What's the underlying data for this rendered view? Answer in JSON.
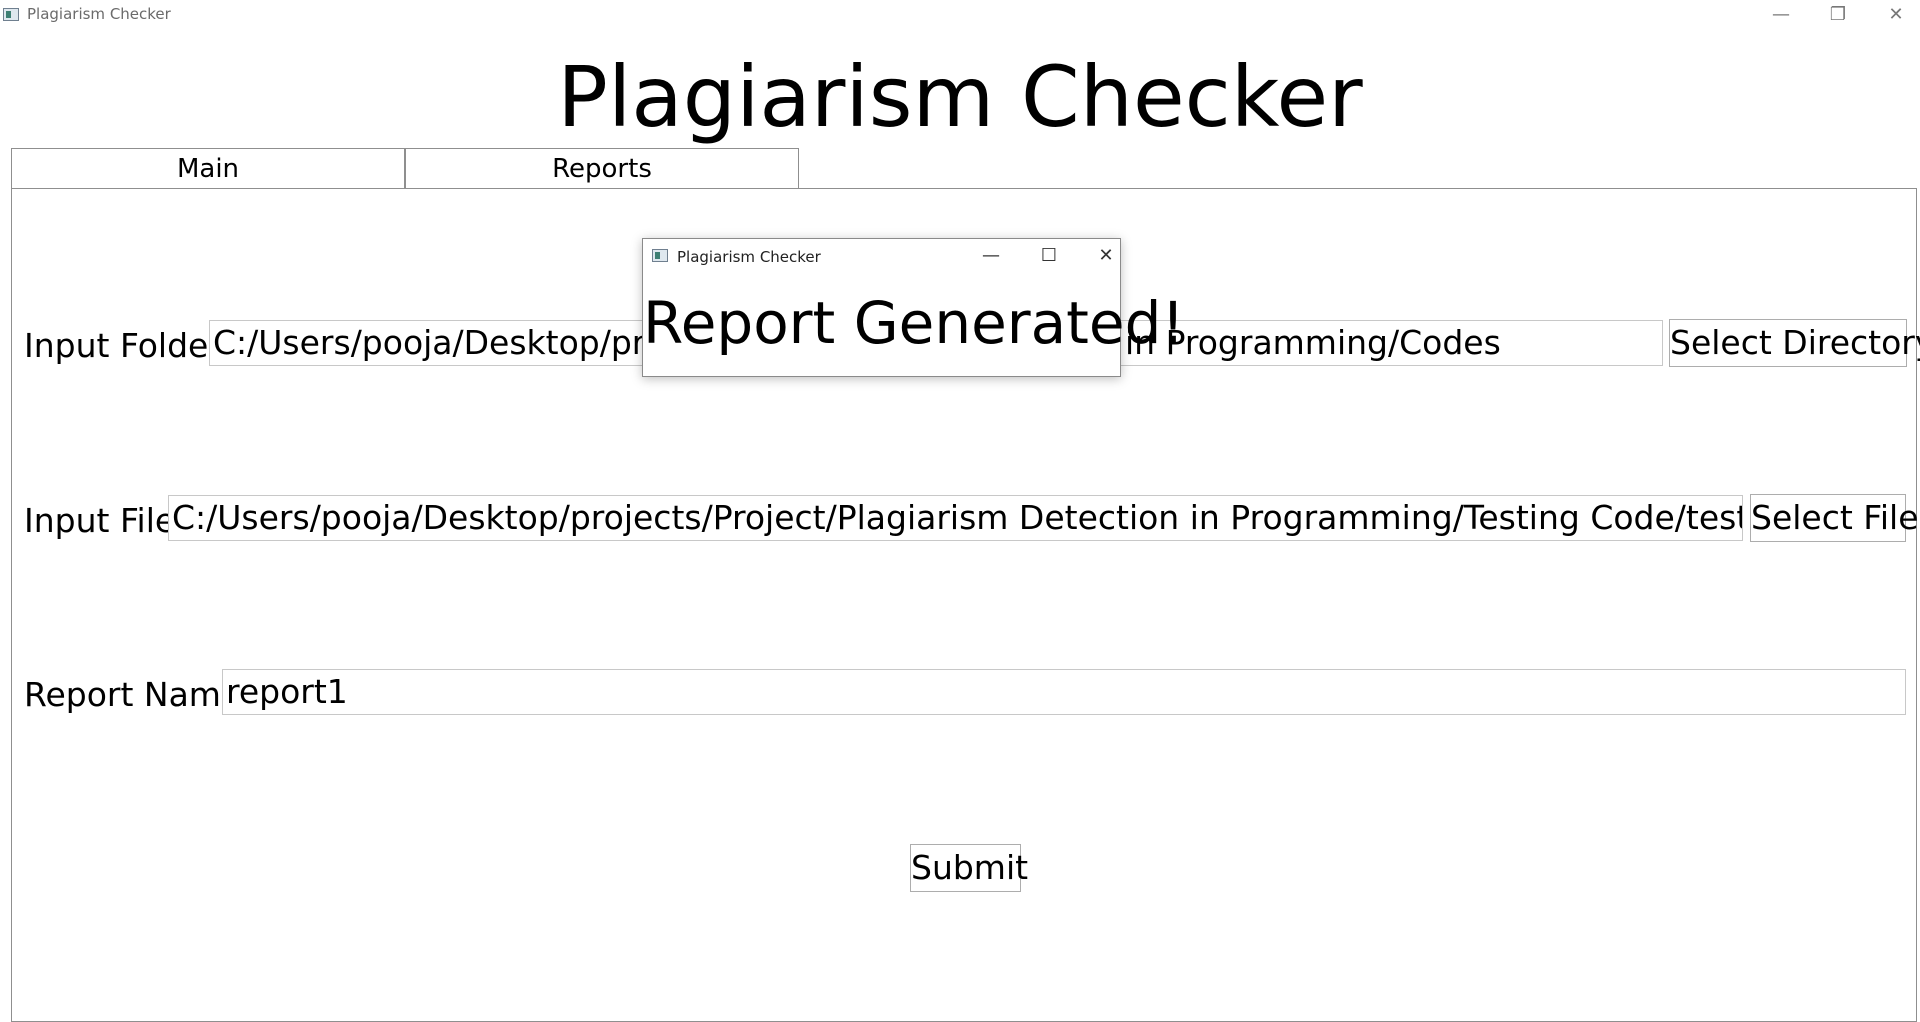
{
  "window": {
    "title": "Plagiarism Checker",
    "minimize_icon": "—",
    "maximize_icon": "❐",
    "close_icon": "✕"
  },
  "header": {
    "title": "Plagiarism Checker"
  },
  "tabs": [
    {
      "label": "Main",
      "active": true
    },
    {
      "label": "Reports",
      "active": false
    }
  ],
  "form": {
    "input_folder": {
      "label": "Input Folder",
      "value_left": "C:/Users/pooja/Desktop/proje",
      "value_right": "in Programming/Codes",
      "button": "Select Directory"
    },
    "input_file": {
      "label": "Input File",
      "value": "C:/Users/pooja/Desktop/projects/Project/Plagiarism Detection in Programming/Testing Code/test.cpp",
      "button": "Select File"
    },
    "report_name": {
      "label": "Report Name",
      "value": "report1"
    },
    "submit": "Submit"
  },
  "dialog": {
    "title": "Plagiarism Checker",
    "minimize_icon": "—",
    "maximize_icon": "☐",
    "close_icon": "✕",
    "message": "Report Generated!"
  }
}
